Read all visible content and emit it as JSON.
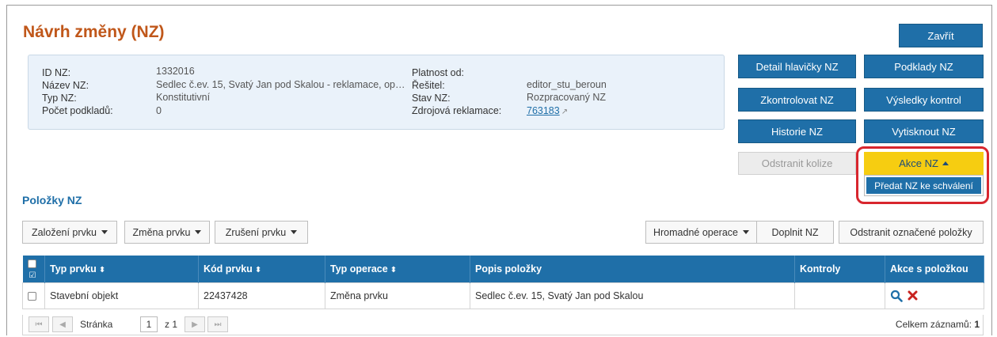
{
  "header": {
    "title": "Návrh změny (NZ)",
    "close_label": "Zavřít"
  },
  "info": {
    "labels": [
      "ID NZ:",
      "Název NZ:",
      "Typ NZ:",
      "Počet podkladů:"
    ],
    "values": [
      "1332016",
      "Sedlec č.ev. 15, Svatý Jan pod Skalou - reklamace, op…",
      "Konstitutivní",
      "0"
    ],
    "labels2": [
      "Platnost od:",
      "Řešitel:",
      "Stav NZ:",
      "Zdrojová reklamace:"
    ],
    "values2": [
      "",
      "editor_stu_beroun",
      "Rozpracovaný NZ",
      "763183"
    ]
  },
  "actions": {
    "detail": "Detail hlavičky NZ",
    "podklady": "Podklady NZ",
    "zkontrolovat": "Zkontrolovat NZ",
    "vysledky": "Výsledky kontrol",
    "historie": "Historie NZ",
    "vytisknout": "Vytisknout NZ",
    "odstranit_kolize": "Odstranit kolize",
    "akce": "Akce NZ",
    "predat": "Předat NZ ke schválení"
  },
  "items": {
    "section_title": "Položky NZ",
    "toolbar": {
      "zalozeni": "Založení prvku",
      "zmena": "Změna prvku",
      "zruseni": "Zrušení prvku",
      "hromadne": "Hromadné operace",
      "doplnit": "Doplnit NZ",
      "odstranit": "Odstranit označené položky"
    },
    "columns": [
      "Typ prvku",
      "Kód prvku",
      "Typ operace",
      "Popis položky",
      "Kontroly",
      "Akce s položkou"
    ],
    "rows": [
      {
        "typ": "Stavební objekt",
        "kod": "22437428",
        "operace": "Změna prvku",
        "popis": "Sedlec č.ev. 15, Svatý Jan pod Skalou",
        "kontroly": ""
      }
    ]
  },
  "pager": {
    "page_label": "Stránka",
    "page": "1",
    "of_label": "z 1",
    "total_label": "Celkem záznamů:",
    "total": "1"
  },
  "colors": {
    "primary": "#1f6fa8",
    "title": "#c0571a",
    "accent_yellow": "#f6cd11",
    "highlight_red": "#d8262e"
  }
}
